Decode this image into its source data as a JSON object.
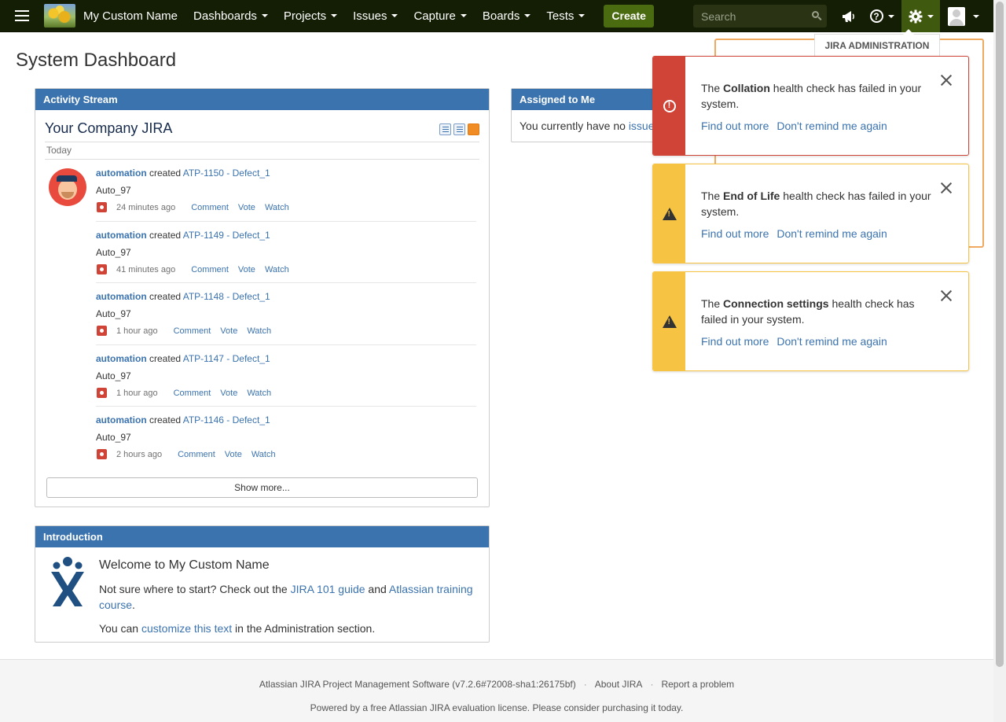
{
  "nav": {
    "brand": "My Custom Name",
    "items": [
      {
        "label": "Dashboards"
      },
      {
        "label": "Projects"
      },
      {
        "label": "Issues"
      },
      {
        "label": "Capture"
      },
      {
        "label": "Boards"
      },
      {
        "label": "Tests"
      }
    ],
    "create_label": "Create",
    "search_placeholder": "Search",
    "help_glyph": "?",
    "colors": {
      "nav_bg": "#141e04",
      "create_bg": "#4a6b0f",
      "gadget_head": "#3b73af",
      "error": "#d04437",
      "warning": "#f6c342"
    }
  },
  "page_title": "System Dashboard",
  "activity": {
    "header": "Activity Stream",
    "title": "Your Company JIRA",
    "today": "Today",
    "items": [
      {
        "user": "automation",
        "verb": "created",
        "issue": "ATP-1150 - Defect_1",
        "summary": "Auto_97",
        "time": "24 minutes ago",
        "actions": [
          "Comment",
          "Vote",
          "Watch"
        ]
      },
      {
        "user": "automation",
        "verb": "created",
        "issue": "ATP-1149 - Defect_1",
        "summary": "Auto_97",
        "time": "41 minutes ago",
        "actions": [
          "Comment",
          "Vote",
          "Watch"
        ]
      },
      {
        "user": "automation",
        "verb": "created",
        "issue": "ATP-1148 - Defect_1",
        "summary": "Auto_97",
        "time": "1 hour ago",
        "actions": [
          "Comment",
          "Vote",
          "Watch"
        ]
      },
      {
        "user": "automation",
        "verb": "created",
        "issue": "ATP-1147 - Defect_1",
        "summary": "Auto_97",
        "time": "1 hour ago",
        "actions": [
          "Comment",
          "Vote",
          "Watch"
        ]
      },
      {
        "user": "automation",
        "verb": "created",
        "issue": "ATP-1146 - Defect_1",
        "summary": "Auto_97",
        "time": "2 hours ago",
        "actions": [
          "Comment",
          "Vote",
          "Watch"
        ]
      }
    ],
    "show_more": "Show more..."
  },
  "assigned": {
    "header": "Assigned to Me",
    "text": "You currently have no",
    "link": "issues"
  },
  "intro": {
    "header": "Introduction",
    "welcome": "Welcome to My Custom Name",
    "p1_pre": "Not sure where to start? Check out the ",
    "p1_link1": "JIRA 101 guide",
    "p1_mid": " and ",
    "p1_link2": "Atlassian training course",
    "p1_post": ".",
    "p2_pre": "You can ",
    "p2_link": "customize this text",
    "p2_post": " in the Administration section."
  },
  "footer": {
    "version": "Atlassian JIRA Project Management Software (v7.2.6#72008-sha1:26175bf)",
    "about": "About JIRA",
    "report": "Report a problem",
    "license": "Powered by a free Atlassian JIRA evaluation license. Please consider purchasing it today."
  },
  "admin_menu": {
    "label": "JIRA ADMINISTRATION"
  },
  "flags": [
    {
      "type": "error",
      "pre": "The ",
      "bold": "Collation",
      "post": " health check has failed in your system.",
      "link1": "Find out more",
      "link2": "Don't remind me again"
    },
    {
      "type": "warning",
      "pre": "The ",
      "bold": "End of Life",
      "post": " health check has failed in your system.",
      "link1": "Find out more",
      "link2": "Don't remind me again"
    },
    {
      "type": "warning",
      "pre": "The ",
      "bold": "Connection settings",
      "post": " health check has failed in your system.",
      "link1": "Find out more",
      "link2": "Don't remind me again"
    }
  ]
}
